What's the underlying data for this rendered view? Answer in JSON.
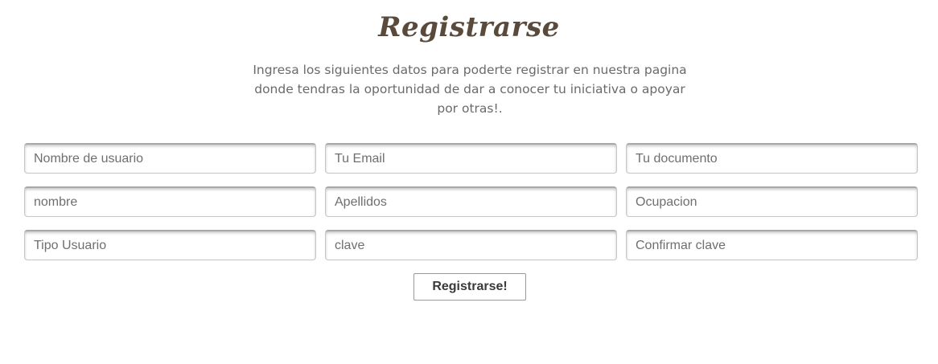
{
  "title": "Registrarse",
  "intro": "Ingresa los siguientes datos para poderte registrar en nuestra pagina donde tendras la oportunidad de dar a conocer tu iniciativa o apoyar por otras!.",
  "fields": [
    {
      "placeholder": "Nombre de usuario"
    },
    {
      "placeholder": "Tu Email"
    },
    {
      "placeholder": "Tu documento"
    },
    {
      "placeholder": "nombre"
    },
    {
      "placeholder": "Apellidos"
    },
    {
      "placeholder": "Ocupacion"
    },
    {
      "placeholder": "Tipo Usuario"
    },
    {
      "placeholder": "clave"
    },
    {
      "placeholder": "Confirmar clave"
    }
  ],
  "submit_label": "Registrarse!",
  "colors": {
    "title": "#5a4a3c",
    "text": "#6a6a6a",
    "border": "#c6c6c6",
    "background": "#ffffff"
  }
}
